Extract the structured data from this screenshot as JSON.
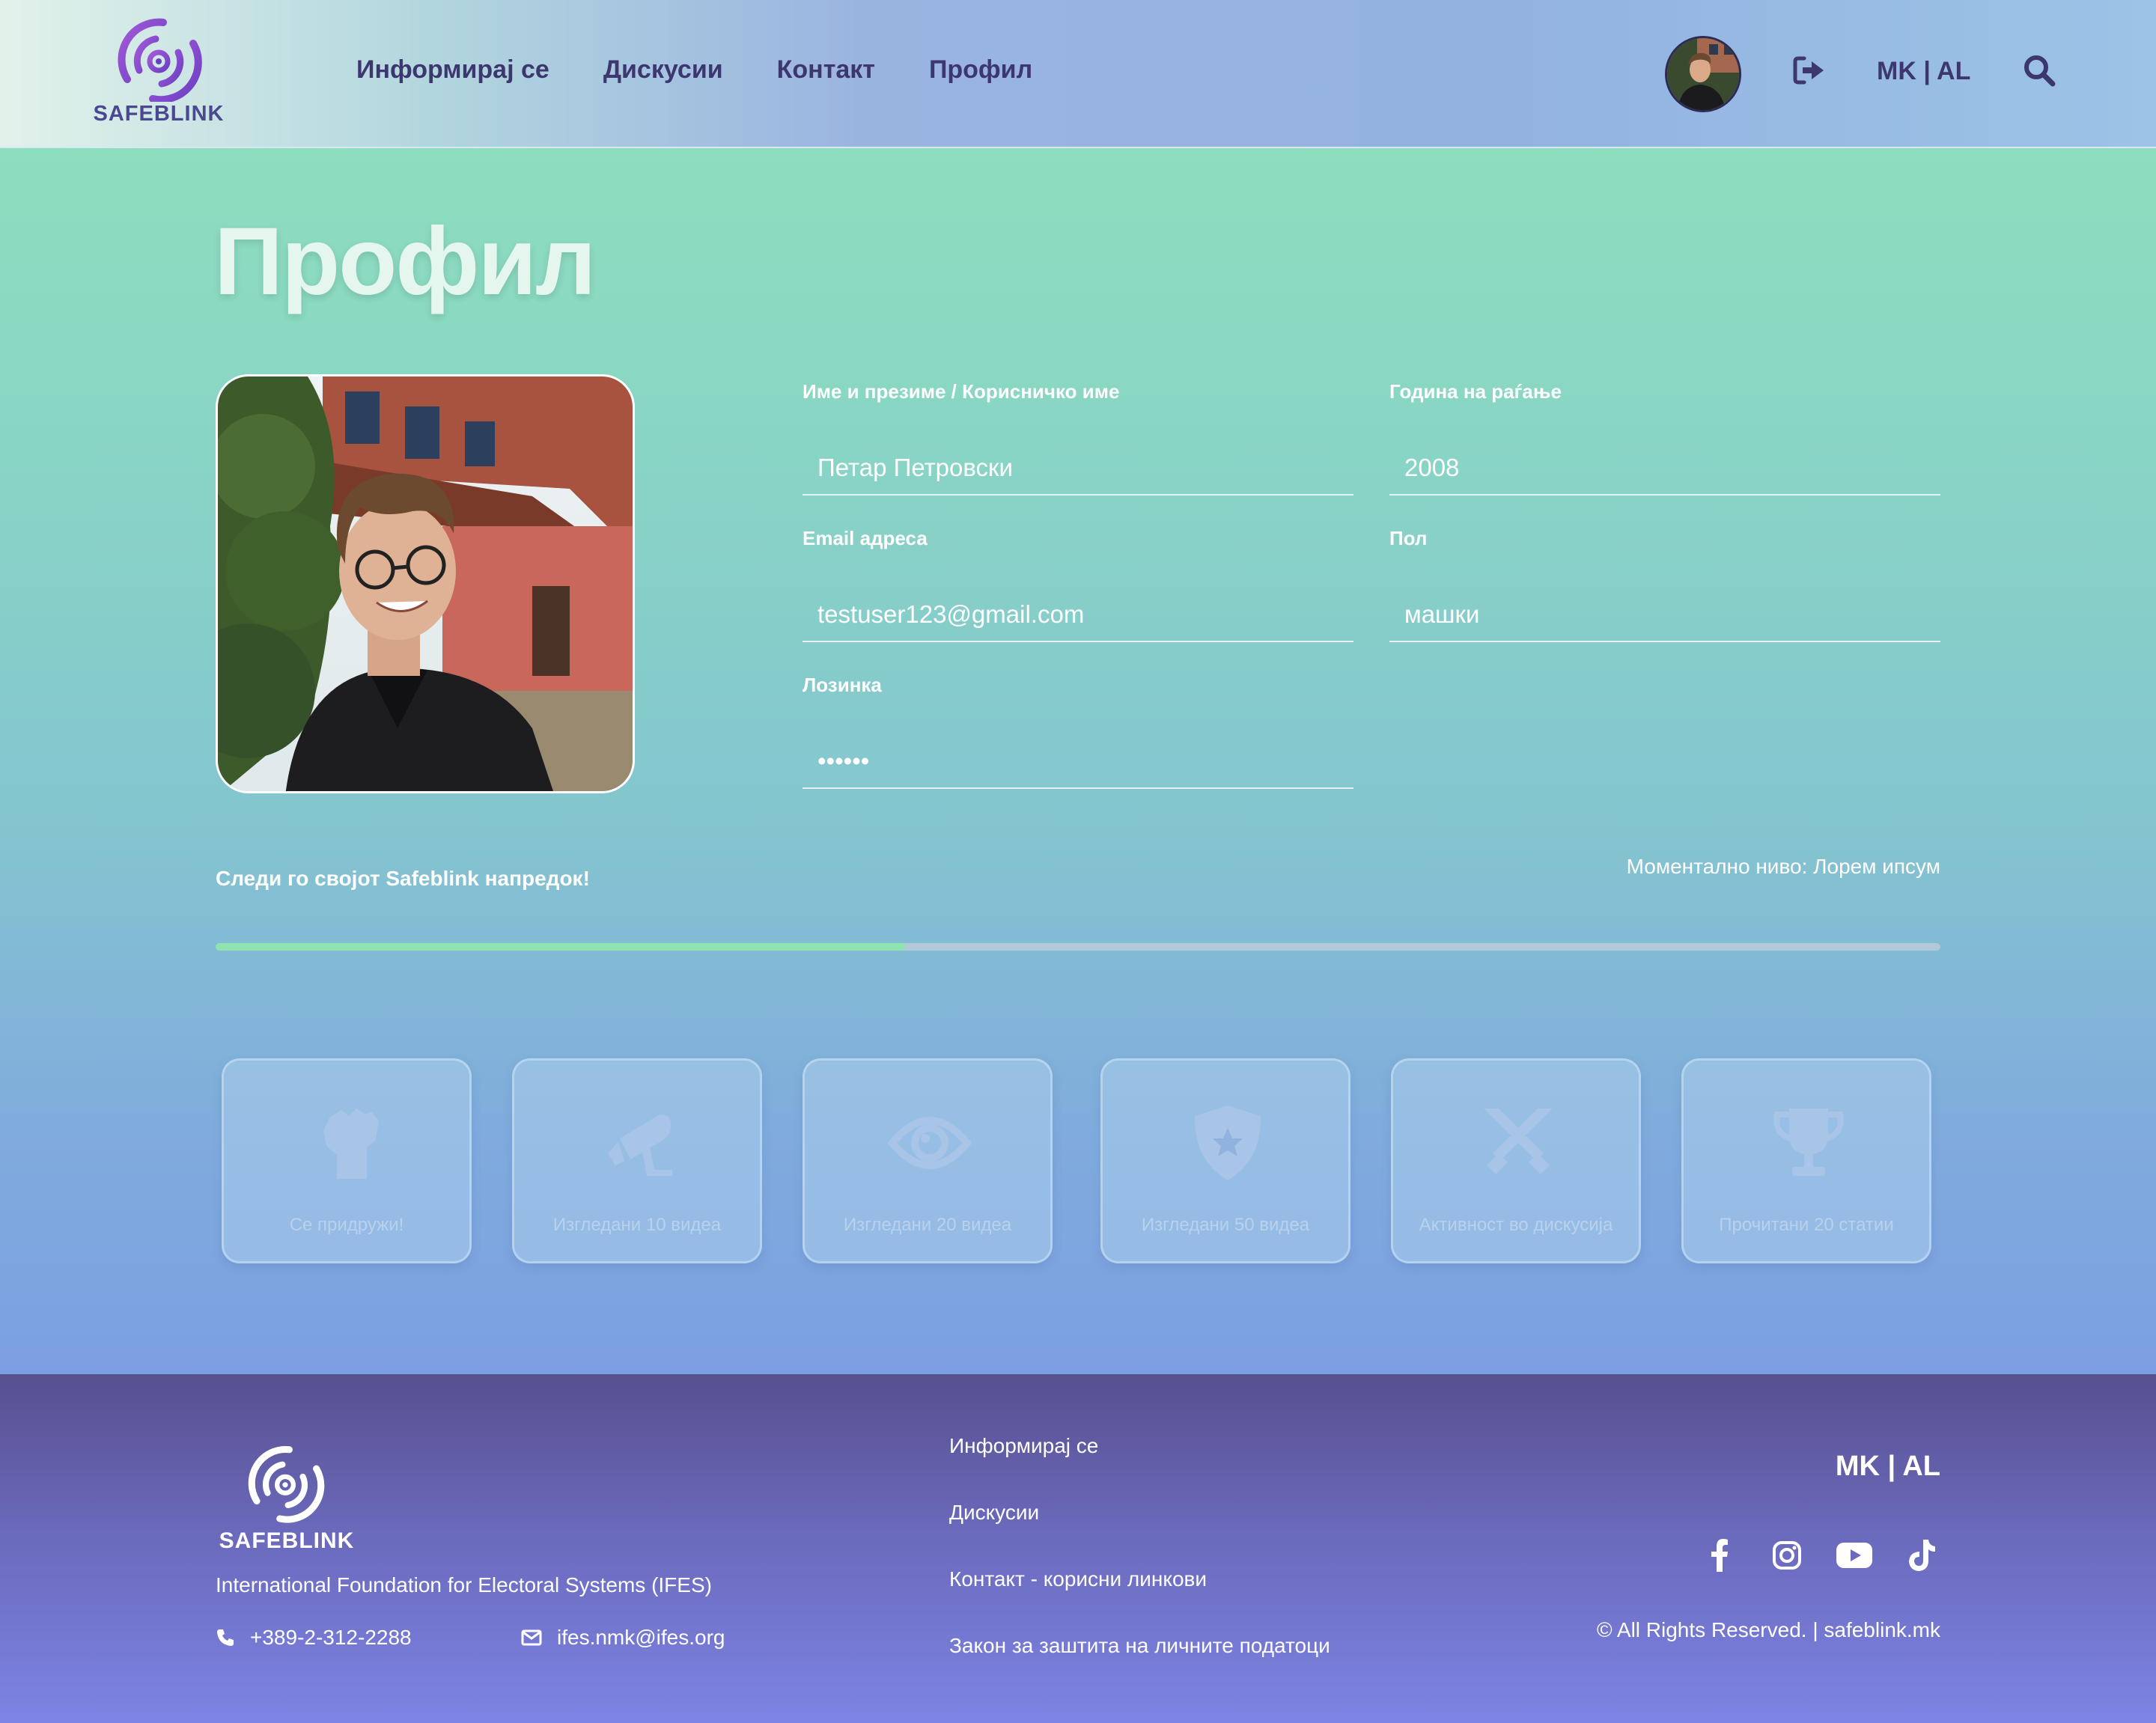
{
  "header": {
    "logo_text": "SAFEBLINK",
    "nav": [
      "Информирај се",
      "Дискусии",
      "Контакт",
      "Профил"
    ],
    "lang": "MK | AL"
  },
  "profile": {
    "title": "Профил",
    "fields": {
      "name": {
        "label": "Име и презиме / Корисничко име",
        "value": "Петар Петровски"
      },
      "birth_year": {
        "label": "Година на раѓање",
        "value": "2008"
      },
      "email": {
        "label": "Email адреса",
        "value": "testuser123@gmail.com"
      },
      "gender": {
        "label": "Пол",
        "value": "машки"
      },
      "password": {
        "label": "Лозинка",
        "value": "••••••"
      }
    },
    "progress": {
      "label": "Следи го својот Safeblink напредок!",
      "level": "Моментално ниво: Лорем ипсум",
      "percent": 40
    }
  },
  "badges": [
    {
      "label": "Се придружи!",
      "icon": "fist-icon"
    },
    {
      "label": "Изгледани 10 видеа",
      "icon": "camera-icon"
    },
    {
      "label": "Изгледани 20 видеа",
      "icon": "eye-icon"
    },
    {
      "label": "Изгледани 50 видеа",
      "icon": "shield-star-icon"
    },
    {
      "label": "Активност во дискусија",
      "icon": "crossed-swords-icon"
    },
    {
      "label": "Прочитани 20 статии",
      "icon": "trophy-icon"
    }
  ],
  "footer": {
    "logo_text": "SAFEBLINK",
    "org": "International Foundation for Electoral Systems (IFES)",
    "phone": "+389-2-312-2288",
    "email": "ifes.nmk@ifes.org",
    "links": [
      "Информирај се",
      "Дискусии",
      "Контакт - корисни линкови",
      "Закон за заштита на личните податоци"
    ],
    "lang": "MK | AL",
    "copyright": "© All Rights Reserved. | safeblink.mk"
  },
  "colors": {
    "accent": "#3d3770",
    "progress_fill": "#8fe3b0",
    "footer_top": "#57508f",
    "footer_bottom": "#7d84e4"
  }
}
